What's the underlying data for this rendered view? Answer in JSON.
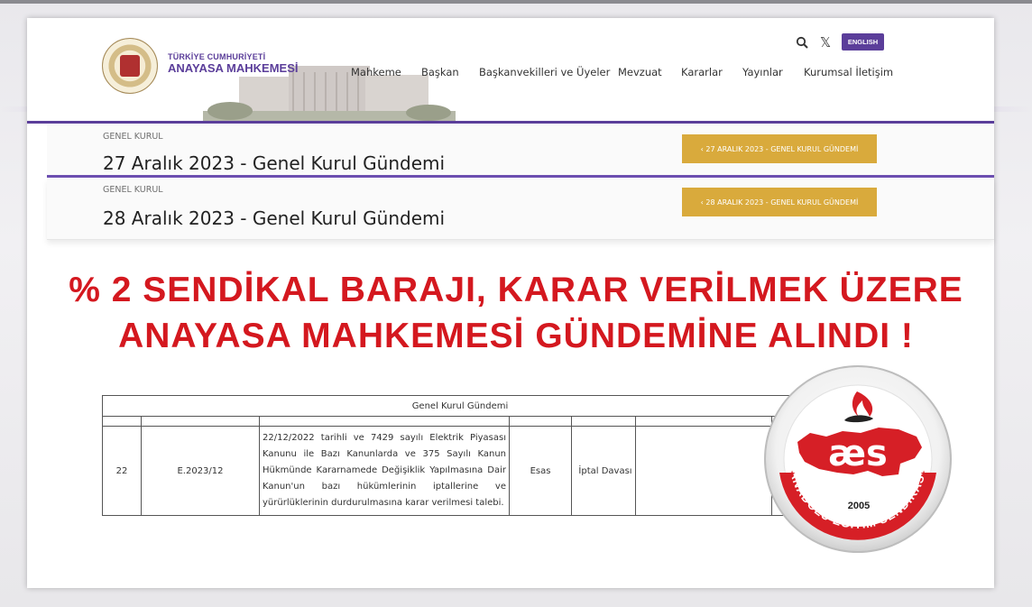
{
  "logo": {
    "line1": "TÜRKİYE CUMHURİYETİ",
    "line2": "ANAYASA MAHKEMESİ"
  },
  "nav": [
    "Mahkeme",
    "Başkan",
    "Başkanvekilleri ve Üyeler",
    "Mevzuat",
    "Kararlar",
    "Yayınlar",
    "Kurumsal İletişim"
  ],
  "header_tools": {
    "search_icon": "search-icon",
    "x_icon": "𝕏",
    "language_button": "ENGLISH"
  },
  "sections": [
    {
      "kicker": "GENEL KURUL",
      "title": "27 Aralık 2023 - Genel Kurul Gündemi",
      "button": "‹ 27 ARALIK 2023 - GENEL KURUL GÜNDEMİ"
    },
    {
      "kicker": "GENEL KURUL",
      "title": "28 Aralık 2023 - Genel Kurul Gündemi",
      "button": "‹ 28 ARALIK 2023 - GENEL KURUL GÜNDEMİ"
    }
  ],
  "headline": {
    "line1": "% 2 SENDİKAL BARAJI, KARAR VERİLMEK ÜZERE",
    "line2": "ANAYASA MAHKEMESİ GÜNDEMİNE ALINDI !"
  },
  "table": {
    "caption": "Genel Kurul Gündemi",
    "row": {
      "no": "22",
      "file": "E.2023/12",
      "description": "22/12/2022 tarihli ve 7429 sayılı Elektrik Piyasası Kanunu ile Bazı Kanunlarda ve 375 Sayılı Kanun Hükmünde Kararnamede Değişiklik Yapılmasına Dair Kanun'un bazı hükümlerinin iptallerine ve yürürlüklerinin durdurulmasına karar verilmesi talebi.",
      "type": "Esas",
      "case": "İptal Davası"
    }
  },
  "badge": {
    "letters": "æs",
    "year": "2005",
    "ring_text": "ANADOLU EĞİTİM SENDİKASI"
  },
  "colors": {
    "brand_purple": "#5b3e9a",
    "gold": "#d9aa3c",
    "headline_red": "#d4181f",
    "aes_red": "#d61f26"
  }
}
